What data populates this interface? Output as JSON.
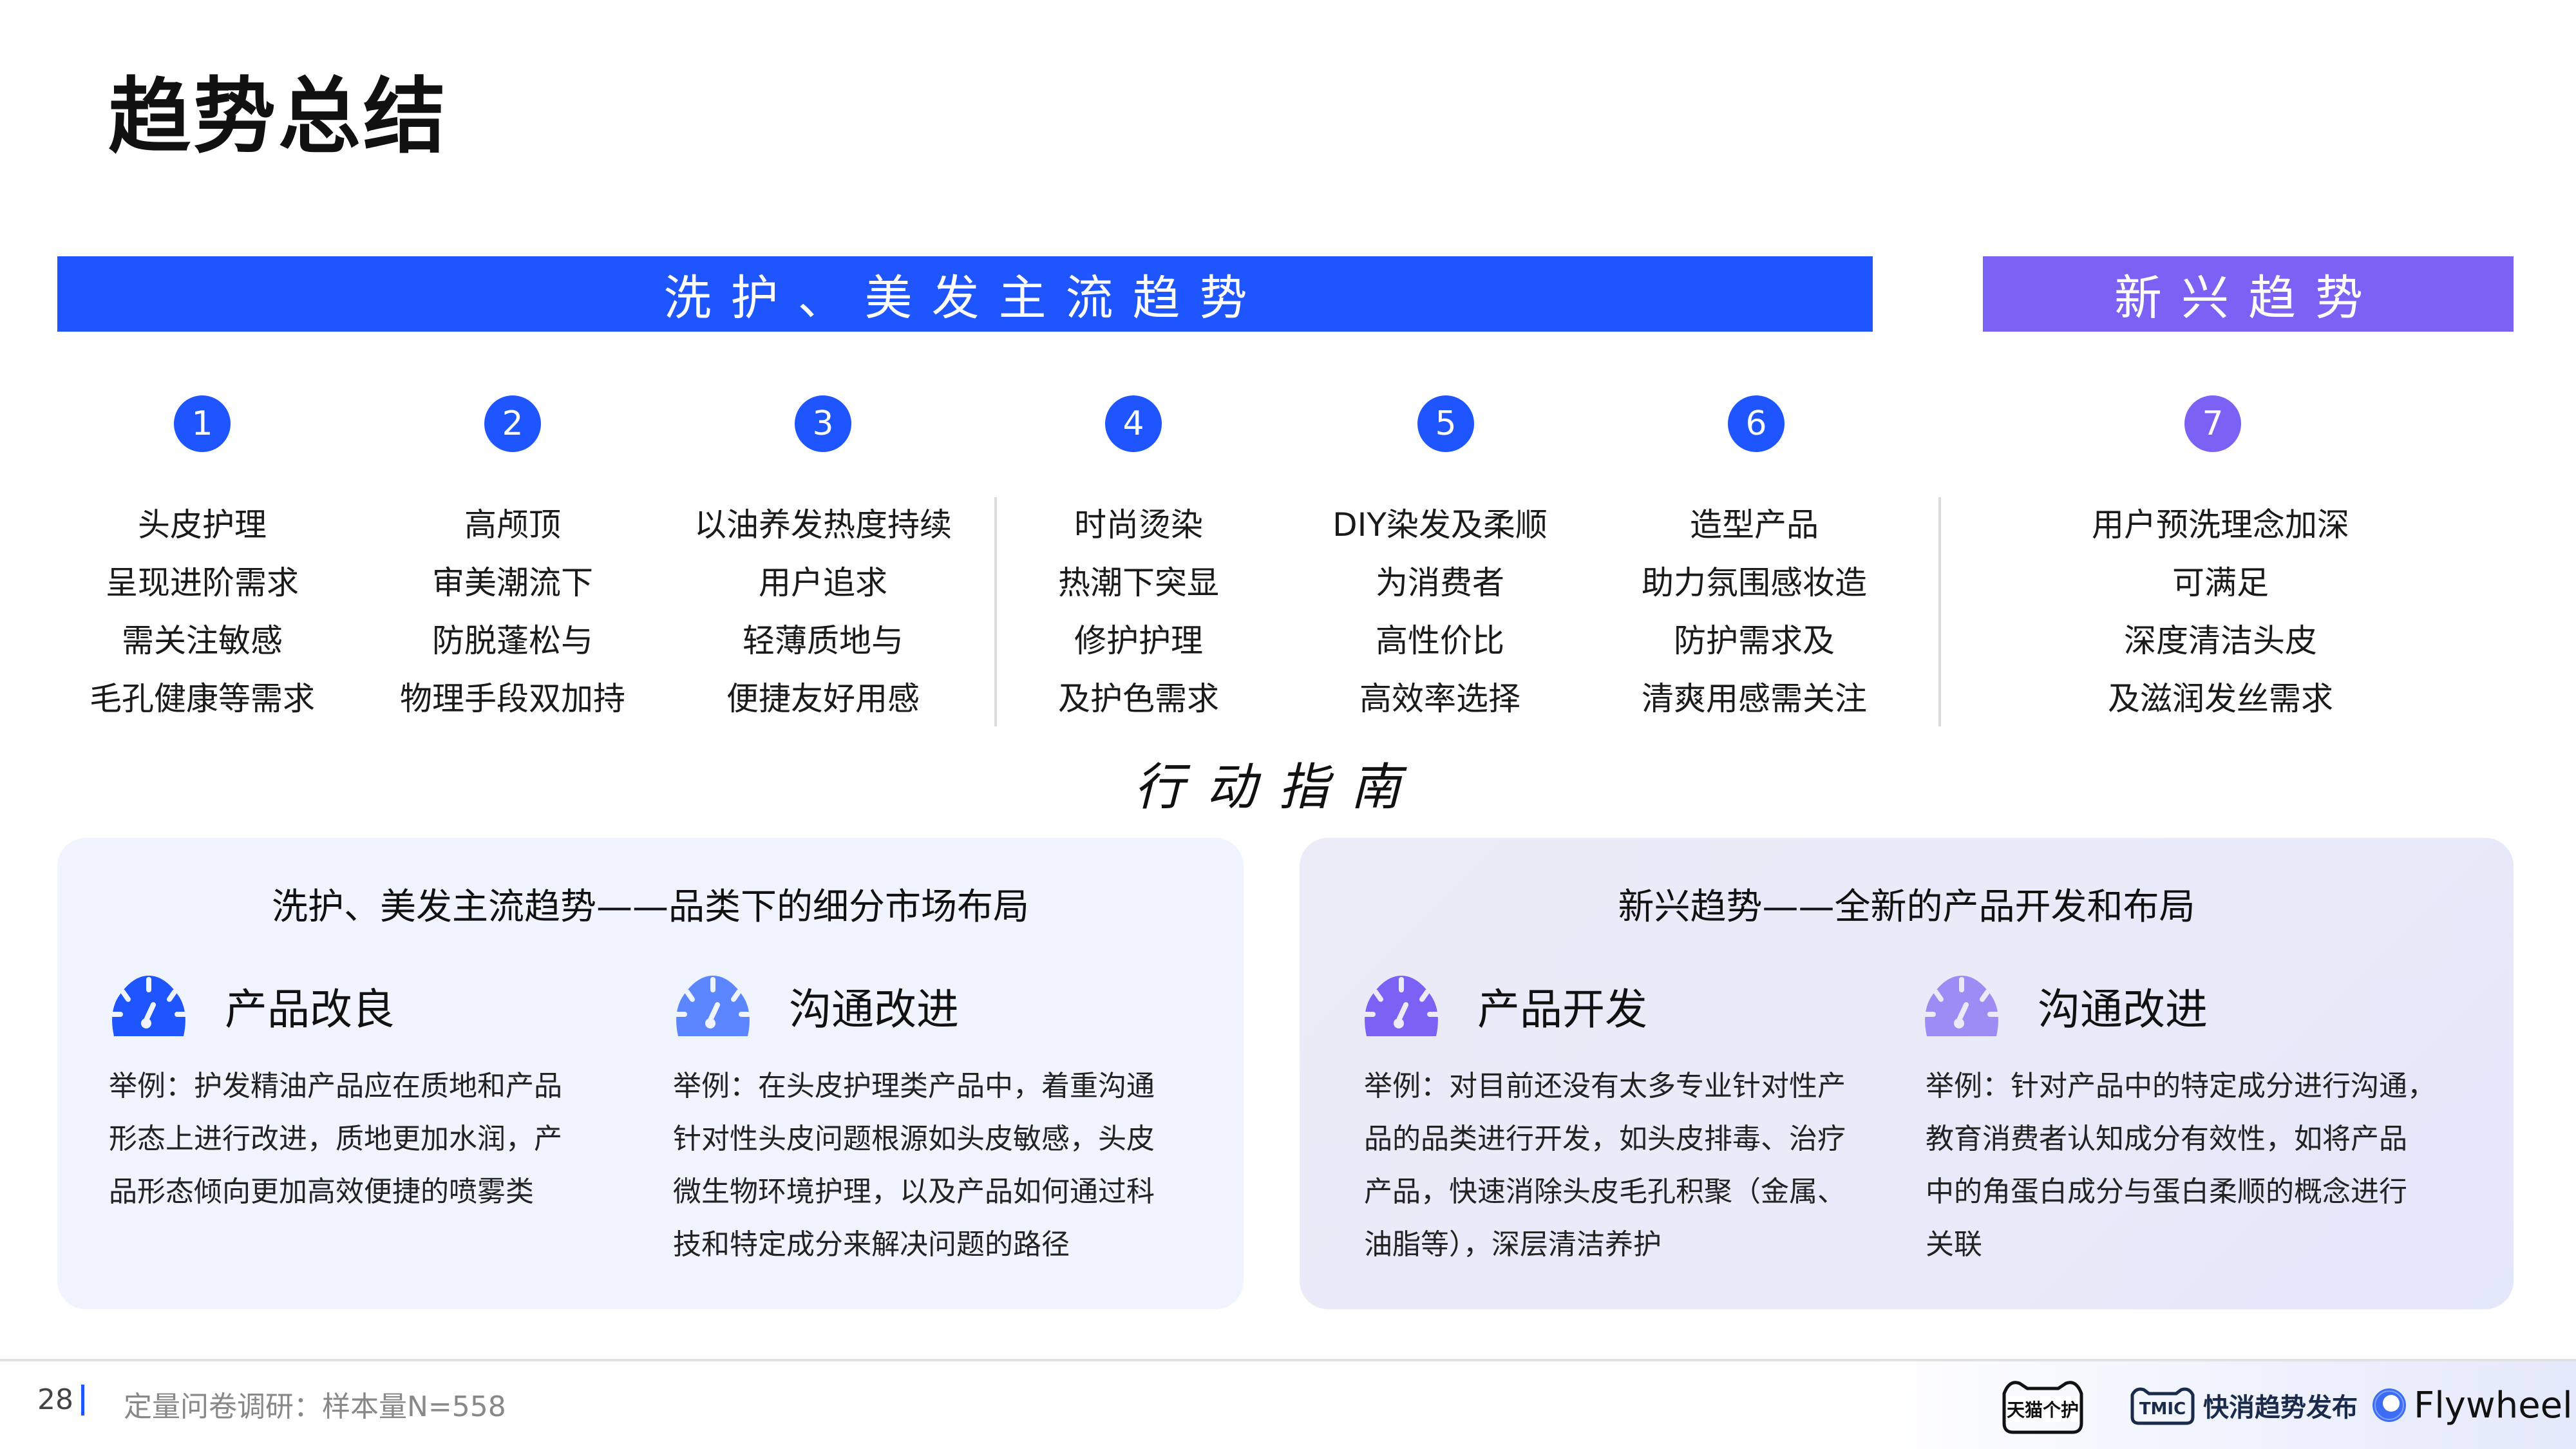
{
  "page": {
    "title": "趋势总结",
    "page_number": "28",
    "source": "定量问卷调研：样本量N=558"
  },
  "banners": {
    "mainstream": "洗护、美发主流趋势",
    "emerging": "新兴趋势"
  },
  "colors": {
    "primary_blue": "#1F55FF",
    "light_blue": "#5B86FF",
    "primary_purple": "#7B62F4",
    "light_purple": "#9E8CF5",
    "card_left_bg": "#EFF4FE",
    "card_right_bg": "#ECEBF8"
  },
  "trends": [
    {
      "number": "1",
      "group": "mainstream",
      "lines": [
        "头皮护理",
        "呈现进阶需求",
        "需关注敏感",
        "毛孔健康等需求"
      ]
    },
    {
      "number": "2",
      "group": "mainstream",
      "lines": [
        "高颅顶",
        "审美潮流下",
        "防脱蓬松与",
        "物理手段双加持"
      ]
    },
    {
      "number": "3",
      "group": "mainstream",
      "lines": [
        "以油养发热度持续",
        "用户追求",
        "轻薄质地与",
        "便捷友好用感"
      ]
    },
    {
      "number": "4",
      "group": "mainstream",
      "lines": [
        "时尚烫染",
        "热潮下突显",
        "修护护理",
        "及护色需求"
      ]
    },
    {
      "number": "5",
      "group": "mainstream",
      "lines": [
        "DIY染发及柔顺",
        "为消费者",
        "高性价比",
        "高效率选择"
      ]
    },
    {
      "number": "6",
      "group": "mainstream",
      "lines": [
        "造型产品",
        "助力氛围感妆造",
        "防护需求及",
        "清爽用感需关注"
      ]
    },
    {
      "number": "7",
      "group": "emerging",
      "lines": [
        "用户预洗理念加深",
        "可满足",
        "深度清洁头皮",
        "及滋润发丝需求"
      ]
    }
  ],
  "action_guide": {
    "heading": "行动指南",
    "cards": [
      {
        "title": "洗护、美发主流趋势——品类下的细分市场布局",
        "items": [
          {
            "icon": "speedometer-icon",
            "label": "产品改良",
            "lines": [
              "举例：护发精油产品应在质地和产品",
              "形态上进行改进，质地更加水润，产",
              "品形态倾向更加高效便捷的喷雾类"
            ]
          },
          {
            "icon": "speedometer-icon",
            "label": "沟通改进",
            "lines": [
              "举例：在头皮护理类产品中，着重沟通",
              "针对性头皮问题根源如头皮敏感，头皮",
              "微生物环境护理，以及产品如何通过科",
              "技和特定成分来解决问题的路径"
            ]
          }
        ]
      },
      {
        "title": "新兴趋势——全新的产品开发和布局",
        "items": [
          {
            "icon": "speedometer-icon",
            "label": "产品开发",
            "lines": [
              "举例：对目前还没有太多专业针对性产",
              "品的品类进行开发，如头皮排毒、治疗",
              "产品，快速消除头皮毛孔积聚（金属、",
              "油脂等），深层清洁养护"
            ]
          },
          {
            "icon": "speedometer-icon",
            "label": "沟通改进",
            "lines": [
              "举例：针对产品中的特定成分进行沟通，",
              "教育消费者认知成分有效性，如将产品",
              "中的角蛋白成分与蛋白柔顺的概念进行",
              "关联"
            ]
          }
        ]
      }
    ]
  },
  "footer": {
    "logos": [
      {
        "name": "tmall-personal-care",
        "text": "天猫个护"
      },
      {
        "name": "tmic",
        "badge": "TMIC",
        "text": "快消趋势发布"
      },
      {
        "name": "flywheel",
        "text": "Flywheel"
      }
    ]
  }
}
